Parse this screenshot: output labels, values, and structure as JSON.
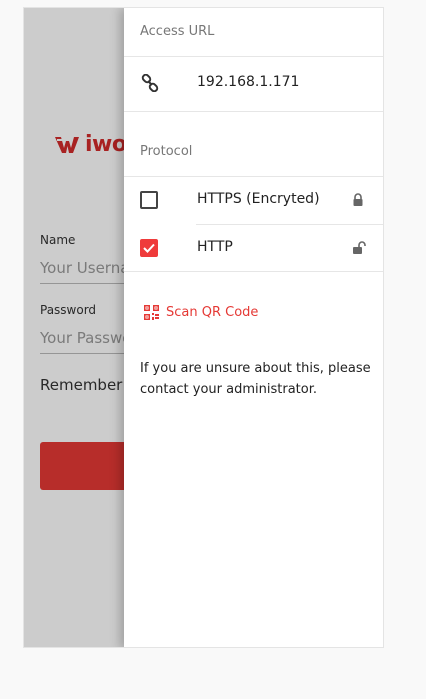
{
  "login": {
    "logo_text": "iwo",
    "name_label": "Name",
    "name_placeholder": "Your Userna",
    "password_label": "Password",
    "password_placeholder": "Your Passwo",
    "remember_label": "Remember"
  },
  "drawer": {
    "access_url_title": "Access URL",
    "access_url_value": "192.168.1.171",
    "protocol_title": "Protocol",
    "protocols": [
      {
        "label": "HTTPS (Encryted)",
        "checked": false,
        "icon": "lock-icon"
      },
      {
        "label": "HTTP",
        "checked": true,
        "icon": "unlock-icon"
      }
    ],
    "qr_label": "Scan QR Code",
    "info_text": "If you are unsure about this, please contact your administrator."
  },
  "colors": {
    "accent": "#e53935",
    "checkbox_checked": "#ef3b3b"
  }
}
